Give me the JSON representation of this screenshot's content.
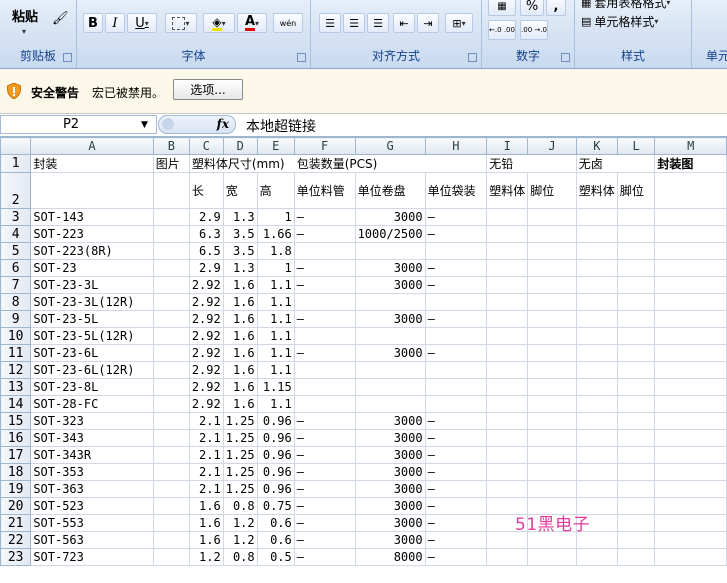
{
  "ribbon": {
    "clipboard": {
      "paste_label": "粘贴",
      "group_label": "剪贴板"
    },
    "font": {
      "bold": "B",
      "italic": "I",
      "underline": "U",
      "font_color_glyph": "A",
      "wen_glyph": "wén",
      "group_label": "字体"
    },
    "alignment": {
      "group_label": "对齐方式"
    },
    "number": {
      "percent": "%",
      "comma": ",",
      "inc_decimal": "←.0 .00",
      "dec_decimal": ".00 →.0",
      "group_label": "数字"
    },
    "styles": {
      "table_format_label": "套用表格格式",
      "cell_style_label": "单元格样式",
      "group_label": "样式"
    },
    "cells": {
      "group_label": "单元"
    }
  },
  "security": {
    "title": "安全警告",
    "message": "宏已被禁用。",
    "options_button": "选项..."
  },
  "formula_bar": {
    "name_box": "P2",
    "fx_label": "fx",
    "content": "本地超链接"
  },
  "columns": [
    "A",
    "B",
    "C",
    "D",
    "E",
    "F",
    "G",
    "H",
    "I",
    "J",
    "K",
    "L",
    "M"
  ],
  "header_row1": {
    "A": "封装",
    "B": "图片",
    "C": "塑料体尺寸(mm)",
    "F": "包装数量(PCS)",
    "I": "无铅",
    "K": "无卤",
    "M": "封装图"
  },
  "header_row2": {
    "C": "长",
    "D": "宽",
    "E": "高",
    "F": "单位料管",
    "G": "单位卷盘",
    "H": "单位袋装",
    "I": "塑料体",
    "J": "脚位",
    "K": "塑料体",
    "L": "脚位"
  },
  "rows": [
    {
      "n": "3",
      "a": "SOT-143",
      "c": "2.9",
      "d": "1.3",
      "e": "1",
      "f": "—",
      "g": "3000",
      "h": "—"
    },
    {
      "n": "4",
      "a": "SOT-223",
      "c": "6.3",
      "d": "3.5",
      "e": "1.66",
      "f": "—",
      "g": "1000/2500",
      "h": "—"
    },
    {
      "n": "5",
      "a": "SOT-223(8R)",
      "c": "6.5",
      "d": "3.5",
      "e": "1.8",
      "f": "",
      "g": "",
      "h": ""
    },
    {
      "n": "6",
      "a": "SOT-23",
      "c": "2.9",
      "d": "1.3",
      "e": "1",
      "f": "—",
      "g": "3000",
      "h": "—"
    },
    {
      "n": "7",
      "a": "SOT-23-3L",
      "c": "2.92",
      "d": "1.6",
      "e": "1.1",
      "f": "—",
      "g": "3000",
      "h": "—"
    },
    {
      "n": "8",
      "a": "SOT-23-3L(12R)",
      "c": "2.92",
      "d": "1.6",
      "e": "1.1",
      "f": "",
      "g": "",
      "h": ""
    },
    {
      "n": "9",
      "a": "SOT-23-5L",
      "c": "2.92",
      "d": "1.6",
      "e": "1.1",
      "f": "—",
      "g": "3000",
      "h": "—"
    },
    {
      "n": "10",
      "a": "SOT-23-5L(12R)",
      "c": "2.92",
      "d": "1.6",
      "e": "1.1",
      "f": "",
      "g": "",
      "h": ""
    },
    {
      "n": "11",
      "a": "SOT-23-6L",
      "c": "2.92",
      "d": "1.6",
      "e": "1.1",
      "f": "—",
      "g": "3000",
      "h": "—"
    },
    {
      "n": "12",
      "a": "SOT-23-6L(12R)",
      "c": "2.92",
      "d": "1.6",
      "e": "1.1",
      "f": "",
      "g": "",
      "h": ""
    },
    {
      "n": "13",
      "a": "SOT-23-8L",
      "c": "2.92",
      "d": "1.6",
      "e": "1.15",
      "f": "",
      "g": "",
      "h": ""
    },
    {
      "n": "14",
      "a": "SOT-28-FC",
      "c": "2.92",
      "d": "1.6",
      "e": "1.1",
      "f": "",
      "g": "",
      "h": ""
    },
    {
      "n": "15",
      "a": "SOT-323",
      "c": "2.1",
      "d": "1.25",
      "e": "0.96",
      "f": "—",
      "g": "3000",
      "h": "—"
    },
    {
      "n": "16",
      "a": "SOT-343",
      "c": "2.1",
      "d": "1.25",
      "e": "0.96",
      "f": "—",
      "g": "3000",
      "h": "—"
    },
    {
      "n": "17",
      "a": "SOT-343R",
      "c": "2.1",
      "d": "1.25",
      "e": "0.96",
      "f": "—",
      "g": "3000",
      "h": "—"
    },
    {
      "n": "18",
      "a": "SOT-353",
      "c": "2.1",
      "d": "1.25",
      "e": "0.96",
      "f": "—",
      "g": "3000",
      "h": "—"
    },
    {
      "n": "19",
      "a": "SOT-363",
      "c": "2.1",
      "d": "1.25",
      "e": "0.96",
      "f": "—",
      "g": "3000",
      "h": "—"
    },
    {
      "n": "20",
      "a": "SOT-523",
      "c": "1.6",
      "d": "0.8",
      "e": "0.75",
      "f": "—",
      "g": "3000",
      "h": "—"
    },
    {
      "n": "21",
      "a": "SOT-553",
      "c": "1.6",
      "d": "1.2",
      "e": "0.6",
      "f": "—",
      "g": "3000",
      "h": "—"
    },
    {
      "n": "22",
      "a": "SOT-563",
      "c": "1.6",
      "d": "1.2",
      "e": "0.6",
      "f": "—",
      "g": "3000",
      "h": "—"
    },
    {
      "n": "23",
      "a": "SOT-723",
      "c": "1.2",
      "d": "0.8",
      "e": "0.5",
      "f": "—",
      "g": "8000",
      "h": "—"
    }
  ],
  "watermark": "51黑电子",
  "colors": {
    "watermark": "#e23b9c",
    "ribbon_text": "#15428b",
    "font_color_underline": "#e00000",
    "fill_color_underline": "#f0e000"
  }
}
